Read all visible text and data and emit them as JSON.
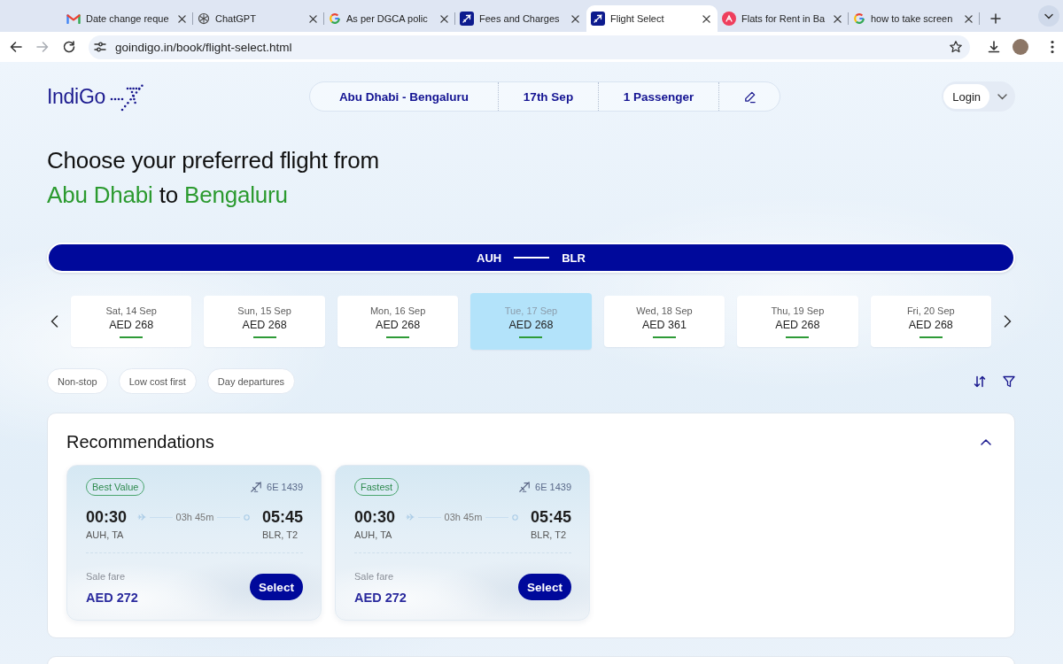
{
  "browser": {
    "tabs": [
      {
        "title": "Date change reque",
        "kind": "mail",
        "selected": false
      },
      {
        "title": "ChatGPT",
        "kind": "chat",
        "selected": false
      },
      {
        "title": "As per DGCA polic",
        "kind": "search",
        "selected": false
      },
      {
        "title": "Fees and Charges",
        "kind": "airline",
        "selected": false
      },
      {
        "title": "Flight Select",
        "kind": "airline",
        "selected": true
      },
      {
        "title": "Flats for Rent in Ba",
        "kind": "listing",
        "selected": false
      },
      {
        "title": "how to take screen",
        "kind": "search",
        "selected": false
      }
    ],
    "forward_disabled": true,
    "address": "goindigo.in/book/flight-select.html"
  },
  "page": {
    "logo": "IndiGo",
    "search_summary": {
      "route": "Abu Dhabi - Bengaluru",
      "date": "17th Sep",
      "passengers": "1 Passenger"
    },
    "login": "Login",
    "heading": {
      "line1": "Choose your preferred flight from",
      "line2": [
        {
          "text": "Abu Dhabi",
          "kind": "place"
        },
        {
          "text": "to",
          "kind": "plain"
        },
        {
          "text": "Bengaluru",
          "kind": "place"
        }
      ]
    },
    "route": {
      "from": "AUH",
      "to": "BLR"
    },
    "dates": [
      {
        "day": "Sat, 14 Sep",
        "fare": "AED 268",
        "selected": false
      },
      {
        "day": "Sun, 15 Sep",
        "fare": "AED 268",
        "selected": false
      },
      {
        "day": "Mon, 16 Sep",
        "fare": "AED 268",
        "selected": false
      },
      {
        "day": "Tue, 17 Sep",
        "fare": "AED 268",
        "selected": true
      },
      {
        "day": "Wed, 18 Sep",
        "fare": "AED 361",
        "selected": false
      },
      {
        "day": "Thu, 19 Sep",
        "fare": "AED 268",
        "selected": false
      },
      {
        "day": "Fri, 20 Sep",
        "fare": "AED 268",
        "selected": false
      }
    ],
    "filters": [
      {
        "label": "Non-stop",
        "selected": false
      },
      {
        "label": "Low cost first",
        "selected": false
      },
      {
        "label": "Day departures",
        "selected": false
      }
    ],
    "recommendations": {
      "title": "Recommendations",
      "expanded": true,
      "flights": [
        {
          "badge": "Best Value",
          "flight_no": "6E 1439",
          "depart": "00:30",
          "depart_airport": "AUH, TA",
          "duration": "03h 45m",
          "arrive": "05:45",
          "arrive_airport": "BLR, T2",
          "fare_label": "Sale fare",
          "fare": "AED 272",
          "button": "Select"
        },
        {
          "badge": "Fastest",
          "flight_no": "6E 1439",
          "depart": "00:30",
          "depart_airport": "AUH, TA",
          "duration": "03h 45m",
          "arrive": "05:45",
          "arrive_airport": "BLR, T2",
          "fare_label": "Sale fare",
          "fare": "AED 272",
          "button": "Select"
        }
      ]
    }
  }
}
